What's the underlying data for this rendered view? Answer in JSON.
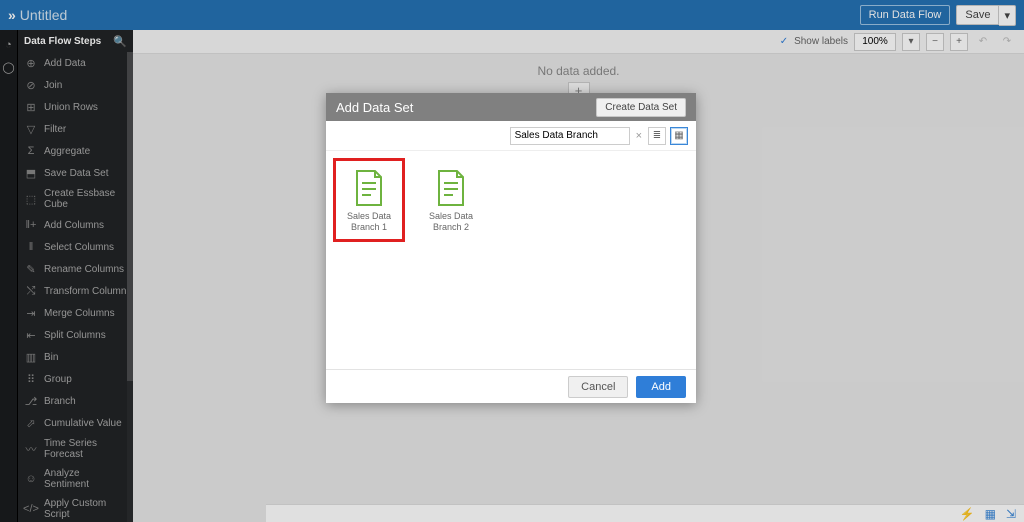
{
  "header": {
    "back_glyph": "»",
    "title": "Untitled",
    "run_label": "Run Data Flow",
    "save_label": "Save",
    "save_split_glyph": "▾"
  },
  "sidebar": {
    "title": "Data Flow Steps",
    "items": [
      {
        "label": "Add Data"
      },
      {
        "label": "Join"
      },
      {
        "label": "Union Rows"
      },
      {
        "label": "Filter"
      },
      {
        "label": "Aggregate"
      },
      {
        "label": "Save Data Set"
      },
      {
        "label": "Create Essbase Cube"
      },
      {
        "label": "Add Columns"
      },
      {
        "label": "Select Columns"
      },
      {
        "label": "Rename Columns"
      },
      {
        "label": "Transform Column"
      },
      {
        "label": "Merge Columns"
      },
      {
        "label": "Split Columns"
      },
      {
        "label": "Bin"
      },
      {
        "label": "Group"
      },
      {
        "label": "Branch"
      },
      {
        "label": "Cumulative Value"
      },
      {
        "label": "Time Series Forecast"
      },
      {
        "label": "Analyze Sentiment"
      },
      {
        "label": "Apply Custom Script"
      }
    ]
  },
  "toolbar": {
    "show_labels": "Show labels",
    "zoom": "100%",
    "zoom_dd": "▾",
    "zoom_out": "−",
    "zoom_in": "+",
    "undo": "↶",
    "redo": "↷"
  },
  "canvas": {
    "message": "No data added.",
    "plus": "+"
  },
  "modal": {
    "title": "Add Data Set",
    "create_label": "Create Data Set",
    "search_value": "Sales Data Branch",
    "clear_glyph": "×",
    "list_glyph": "≣",
    "grid_glyph": "▦",
    "tiles": [
      {
        "label": "Sales Data Branch 1",
        "selected": true
      },
      {
        "label": "Sales Data Branch 2",
        "selected": false
      }
    ],
    "cancel_label": "Cancel",
    "add_label": "Add"
  },
  "statusbar": {
    "icon1": "⚡",
    "icon2": "▦",
    "icon3": "⇲"
  }
}
